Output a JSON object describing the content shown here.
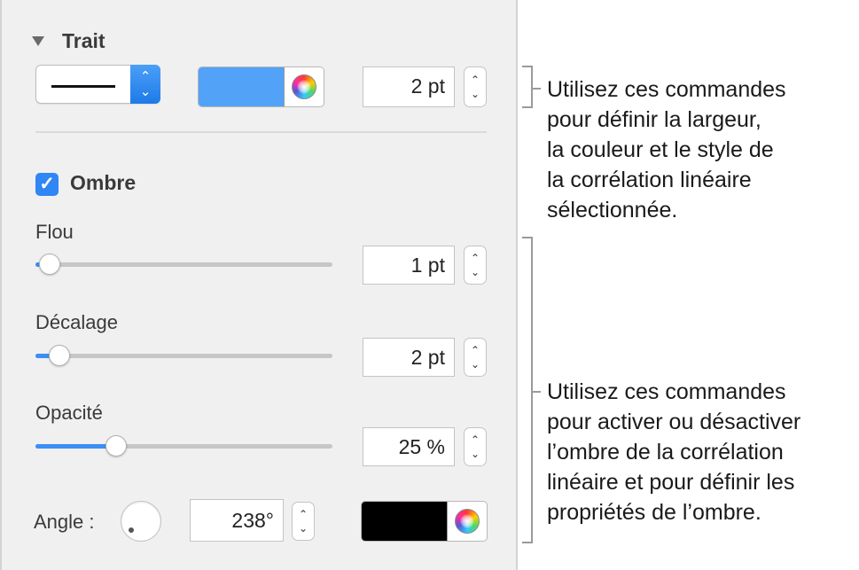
{
  "stroke": {
    "title": "Trait",
    "width_value": "2 pt",
    "color": "#52a2f8"
  },
  "shadow": {
    "checkbox_mark": "✓",
    "title": "Ombre",
    "checked": true,
    "blur": {
      "label": "Flou",
      "value": "1 pt",
      "slider_level": 0.04
    },
    "offset": {
      "label": "Décalage",
      "value": "2 pt",
      "slider_level": 0.07
    },
    "opacity": {
      "label": "Opacité",
      "value": "25 %",
      "slider_level": 0.27
    },
    "angle": {
      "label": "Angle :",
      "value": "238°"
    },
    "color": "#000000"
  },
  "icons": {
    "disclosure": "disclosure-triangle-icon",
    "popup_arrows": "chevron-up-down-icon",
    "color_picker": "color-wheel-icon",
    "stepper": "stepper-arrows-icon"
  },
  "stepper_glyphs": {
    "up": "⌃",
    "down": "⌄"
  },
  "callouts": {
    "stroke_text": [
      "Utilisez ces commandes",
      "pour définir la largeur,",
      "la couleur et le style de",
      "la corrélation linéaire",
      "sélectionnée."
    ],
    "shadow_text": [
      "Utilisez ces commandes",
      "pour activer ou désactiver",
      "l’ombre de la corrélation",
      "linéaire et pour définir les",
      "propriétés de l’ombre."
    ]
  }
}
